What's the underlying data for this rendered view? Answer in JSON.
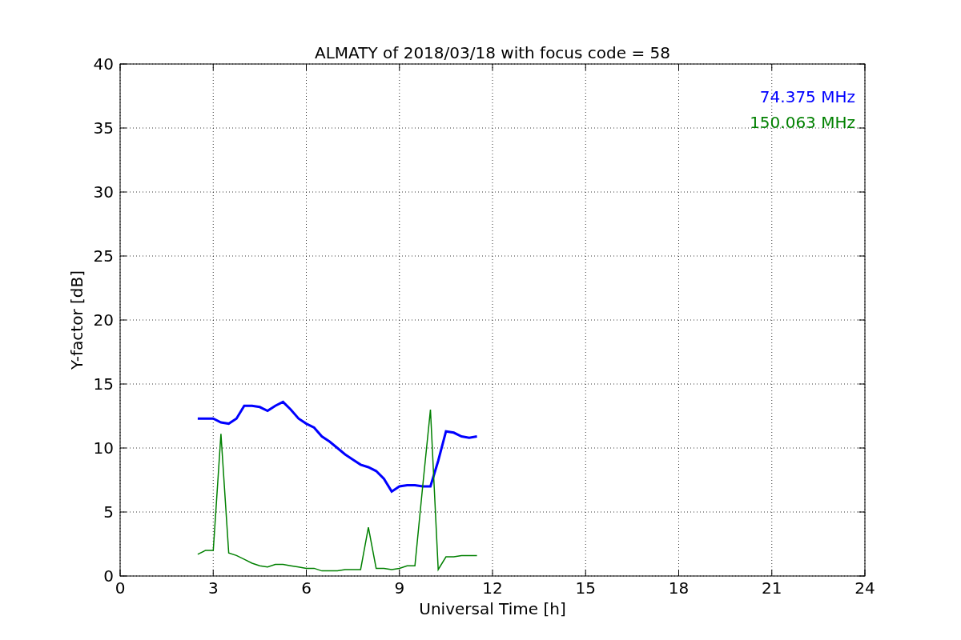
{
  "chart_data": {
    "type": "line",
    "title": "ALMATY of 2018/03/18 with focus code = 58",
    "xlabel": "Universal Time [h]",
    "ylabel": "Y-factor [dB]",
    "x": [
      2.5,
      2.75,
      3.0,
      3.25,
      3.5,
      3.75,
      4.0,
      4.25,
      4.5,
      4.75,
      5.0,
      5.25,
      5.5,
      5.75,
      6.0,
      6.25,
      6.5,
      6.75,
      7.0,
      7.25,
      7.5,
      7.75,
      8.0,
      8.25,
      8.5,
      8.75,
      9.0,
      9.25,
      9.5,
      9.75,
      10.0,
      10.25,
      10.5,
      10.75,
      11.0,
      11.25,
      11.5
    ],
    "series": [
      {
        "name": "74.375 MHz",
        "color": "#0000ff",
        "values": [
          12.3,
          12.3,
          12.3,
          12.0,
          11.9,
          12.3,
          13.3,
          13.3,
          13.2,
          12.9,
          13.3,
          13.6,
          13.0,
          12.3,
          11.9,
          11.6,
          10.9,
          10.5,
          10.0,
          9.5,
          9.1,
          8.7,
          8.5,
          8.2,
          7.6,
          6.6,
          7.0,
          7.1,
          7.1,
          7.0,
          7.0,
          9.0,
          11.3,
          11.2,
          10.9,
          10.8,
          10.9
        ]
      },
      {
        "name": "150.063 MHz",
        "color": "#008000",
        "values": [
          1.7,
          2.0,
          2.0,
          11.1,
          1.8,
          1.6,
          1.3,
          1.0,
          0.8,
          0.7,
          0.9,
          0.9,
          0.8,
          0.7,
          0.6,
          0.6,
          0.4,
          0.4,
          0.4,
          0.5,
          0.5,
          0.5,
          3.8,
          0.6,
          0.6,
          0.5,
          0.6,
          0.8,
          0.8,
          7.0,
          13.0,
          0.5,
          1.5,
          1.5,
          1.6,
          1.6,
          1.6
        ]
      }
    ],
    "xlim": [
      0,
      24
    ],
    "ylim": [
      0,
      40
    ],
    "xticks": [
      0,
      3,
      6,
      9,
      12,
      15,
      18,
      21,
      24
    ],
    "yticks": [
      0,
      5,
      10,
      15,
      20,
      25,
      30,
      35,
      40
    ],
    "grid": true
  }
}
